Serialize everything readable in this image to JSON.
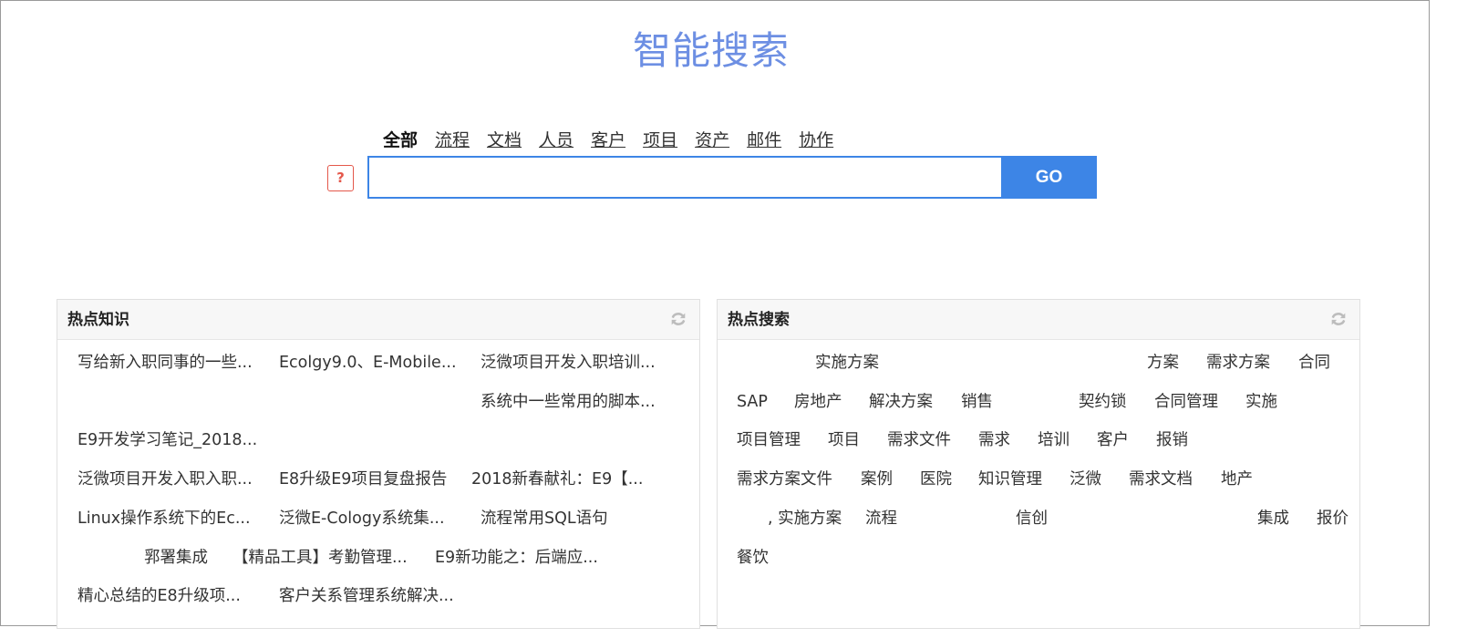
{
  "page": {
    "title": "智能搜索"
  },
  "search": {
    "tabs": [
      "全部",
      "流程",
      "文档",
      "人员",
      "客户",
      "项目",
      "资产",
      "邮件",
      "协作"
    ],
    "active_tab": "全部",
    "help_label": "?",
    "input_value": "",
    "go_label": "GO"
  },
  "hot_knowledge": {
    "title": "热点知识",
    "items": [
      "写给新入职同事的一些...",
      "Ecolgy9.0、E-Mobile...",
      "泛微项目开发入职培训...",
      "系统中一些常用的脚本...",
      "E9开发学习笔记_2018...",
      "泛微项目开发入职入职...",
      "E8升级E9项目复盘报告",
      "2018新春献礼：E9【...",
      "Linux操作系统下的Ec...",
      "泛微E-Cology系统集...",
      "流程常用SQL语句",
      "郛署集成",
      "【精品工具】考勤管理...",
      "E9新功能之：后端应...",
      "精心总结的E8升级项...",
      "客户关系管理系统解决..."
    ]
  },
  "hot_search": {
    "title": "热点搜索",
    "items": [
      "实施方案",
      "方案",
      "需求方案",
      "合同",
      "SAP",
      "房地产",
      "解决方案",
      "销售",
      "契约锁",
      "合同管理",
      "实施",
      "项目管理",
      "项目",
      "需求文件",
      "需求",
      "培训",
      "客户",
      "报销",
      "需求方案文件",
      "案例",
      "医院",
      "知识管理",
      "泛微",
      "需求文档",
      "地产",
      ", 实施方案",
      "流程",
      "信创",
      "集成",
      "报价",
      "餐饮"
    ]
  },
  "colors": {
    "accent": "#3d85e6",
    "title": "#6d8fe3",
    "help": "#e4574a"
  }
}
